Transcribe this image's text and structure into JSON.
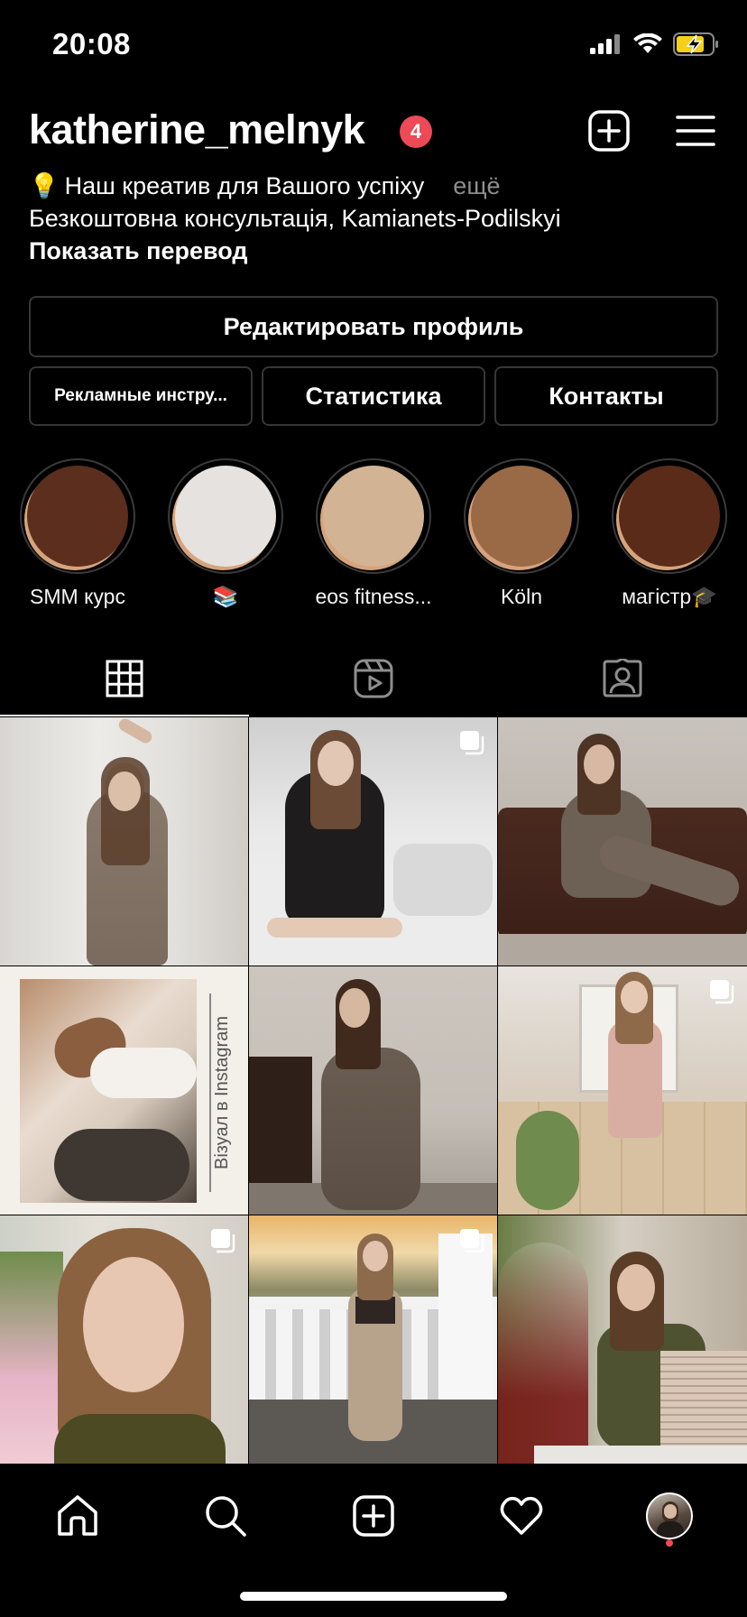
{
  "status_bar": {
    "time": "20:08"
  },
  "profile": {
    "username": "katherine_melnyk",
    "notification_count": "4",
    "bio_line1_emoji": "💡",
    "bio_line1": "Наш креатив для Вашого успіху",
    "bio_more": "ещё",
    "bio_line2": "Безкоштовна консультація, Kamianets-Podilskyi",
    "translate": "Показать перевод"
  },
  "buttons": {
    "edit_profile": "Редактировать профиль",
    "ad_tools": "Рекламные инстру...",
    "statistics": "Статистика",
    "contacts": "Контакты"
  },
  "highlights": [
    {
      "label": "SMM курс",
      "color": "#5c2e1d"
    },
    {
      "label": "📚",
      "color": "#e6e2df"
    },
    {
      "label": "eos fitness...",
      "color": "#d2b393"
    },
    {
      "label": "Köln",
      "color": "#9a6a46"
    },
    {
      "label": "магістр🎓",
      "color": "#5a2b18"
    }
  ],
  "tabs": [
    {
      "icon": "grid-icon",
      "active": true
    },
    {
      "icon": "reels-icon",
      "active": false
    },
    {
      "icon": "tagged-icon",
      "active": false
    }
  ],
  "grid_text": {
    "tile4_caption": "Візуал в Instagram"
  },
  "bottom_nav": [
    "home-icon",
    "search-icon",
    "new-post-icon",
    "activity-heart-icon",
    "profile-avatar"
  ],
  "colors": {
    "badge": "#ed4956",
    "background": "#000000",
    "border": "#363636"
  }
}
